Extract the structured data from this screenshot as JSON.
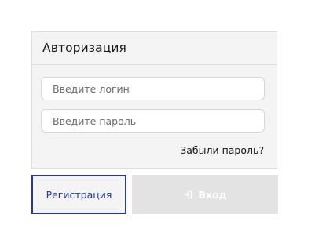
{
  "auth": {
    "title": "Авторизация",
    "login_placeholder": "Введите логин",
    "login_value": "",
    "password_placeholder": "Введите пароль",
    "password_value": "",
    "forgot_password": "Забыли пароль?"
  },
  "buttons": {
    "register_label": "Регистрация",
    "login_label": "Вход",
    "login_icon": "sign-in-icon"
  },
  "colors": {
    "register_accent": "#2a3a8f",
    "login_disabled_bg": "#e3e3e3",
    "panel_bg": "#f4f4f5"
  }
}
